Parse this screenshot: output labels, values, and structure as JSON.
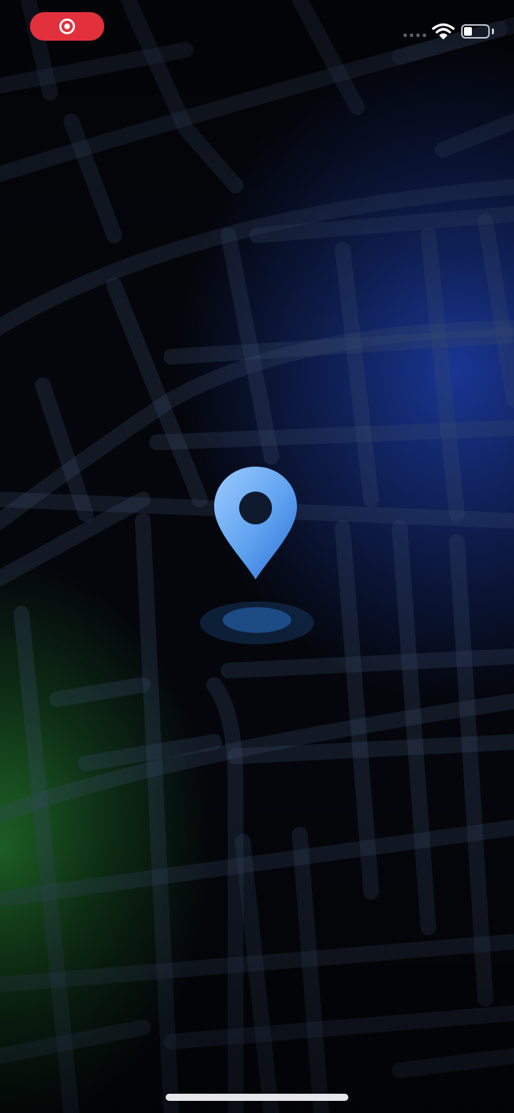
{
  "status_bar": {
    "recording_icon": "screen-recording-icon",
    "signal_icon": "cellular-signal-icon",
    "wifi_icon": "wifi-icon",
    "battery_icon": "battery-icon",
    "battery_level": 0.35,
    "colors": {
      "recording_pill": "#e2303c",
      "icons": "#ffffff"
    }
  },
  "content": {
    "pin_icon": "location-pin-icon",
    "pin_shadow": "pin-ground-shadow",
    "background": "dark-street-map",
    "colors": {
      "pin_light": "#8ec3ff",
      "pin_dark": "#2a6fd6",
      "map_roads": "#2a3750",
      "glow_blue": "#1c3eaa",
      "glow_green": "#24782c"
    }
  },
  "home_indicator": "home-indicator-bar"
}
